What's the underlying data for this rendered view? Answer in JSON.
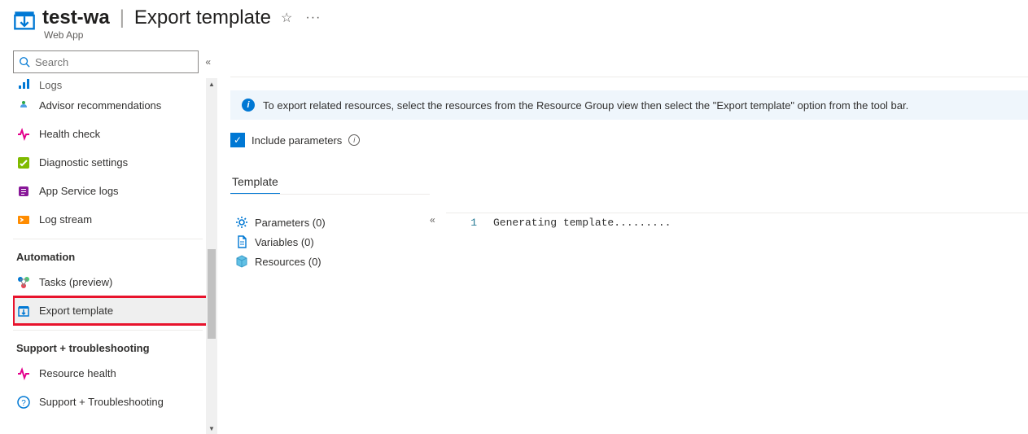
{
  "header": {
    "resource_name": "test-wa",
    "separator": "|",
    "page_title": "Export template",
    "subtitle": "Web App"
  },
  "sidebar": {
    "search_placeholder": "Search",
    "items_top_cut": "Logs",
    "items": [
      {
        "label": "Advisor recommendations"
      },
      {
        "label": "Health check"
      },
      {
        "label": "Diagnostic settings"
      },
      {
        "label": "App Service logs"
      },
      {
        "label": "Log stream"
      }
    ],
    "group_automation": "Automation",
    "automation_items": [
      {
        "label": "Tasks (preview)"
      },
      {
        "label": "Export template"
      }
    ],
    "group_support": "Support + troubleshooting",
    "support_items": [
      {
        "label": "Resource health"
      },
      {
        "label": "Support + Troubleshooting"
      }
    ]
  },
  "main": {
    "banner": "To export related resources, select the resources from the Resource Group view then select the \"Export template\" option from the tool bar.",
    "include_parameters_label": "Include parameters",
    "tab_template": "Template",
    "tree": {
      "parameters": "Parameters (0)",
      "variables": "Variables (0)",
      "resources": "Resources (0)"
    },
    "editor": {
      "line_no": "1",
      "code_line": "Generating template........."
    }
  }
}
